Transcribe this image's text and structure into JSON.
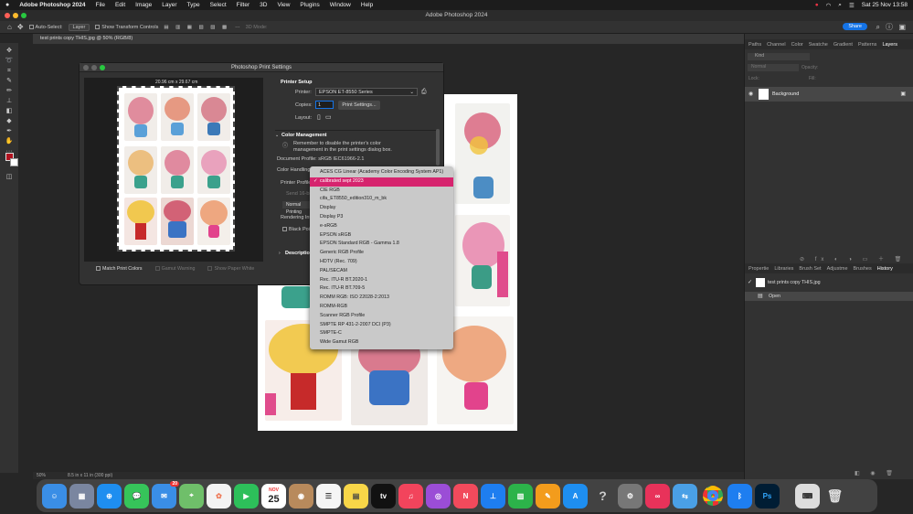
{
  "menubar": {
    "apple": "",
    "app": "Adobe Photoshop 2024",
    "items": [
      "File",
      "Edit",
      "Image",
      "Layer",
      "Type",
      "Select",
      "Filter",
      "3D",
      "View",
      "Plugins",
      "Window",
      "Help"
    ],
    "clock": "Sat 25 Nov 13:58"
  },
  "window": {
    "title": "Adobe Photoshop 2024"
  },
  "options": {
    "auto_select": "Auto-Select:",
    "layer": "Layer",
    "transform": "Show Transform Controls",
    "mode3d": "3D Mode:",
    "share": "Share"
  },
  "document": {
    "tab": "test prints copy THIS.jpg @ 50% (RGB/8)",
    "zoom": "50%",
    "info": "8.5 in x 11 in (300 ppi)"
  },
  "panels": {
    "top_tabs": [
      "Paths",
      "Channel",
      "Color",
      "Swatche",
      "Gradient",
      "Patterns",
      "Layers"
    ],
    "kind": "Kind",
    "normal": "Normal",
    "opacity": "Opacity:",
    "fill": "Fill:",
    "lock": "Lock:",
    "layer_name": "Background",
    "mid_tabs": [
      "Propertie",
      "Libraries",
      "Brush Set",
      "Adjustme",
      "Brushes",
      "History"
    ],
    "history_snapshot": "test prints copy THIS.jpg",
    "history_state": "Open"
  },
  "dialog": {
    "title": "Photoshop Print Settings",
    "size_label": "20.96 cm x 29.67 cm",
    "printer_setup": "Printer Setup",
    "printer_label": "Printer:",
    "printer_value": "EPSON ET-8550 Series",
    "copies_label": "Copies:",
    "copies_value": "1",
    "print_settings_btn": "Print Settings...",
    "layout_label": "Layout:",
    "color_mgmt": "Color Management",
    "reminder": "Remember to disable the printer's color management in the print settings dialog box.",
    "doc_profile": "Document Profile: sRGB IEC61966-2.1",
    "color_handling": "Color Handling:",
    "printer_profile": "Printer Profile:",
    "send16": "Send 16-bit",
    "normal_print": "Normal Printing",
    "rendering": "Rendering Int",
    "black_point": "Black Point",
    "description": "Description",
    "match_colors": "Match Print Colors",
    "gamut": "Gamut Warning",
    "paper_white": "Show Paper White"
  },
  "profiles": {
    "selected_index": 1,
    "items": [
      "ACES CG Linear (Academy Color Encoding System AP1)",
      "calibrated sept 2023",
      "CIE RGB",
      "cifa_ET8550_edition310_m_bk",
      "Display",
      "Display P3",
      "e-sRGB",
      "EPSON  sRGB",
      "EPSON  Standard RGB - Gamma 1.8",
      "Generic RGB Profile",
      "HDTV (Rec. 709)",
      "PAL/SECAM",
      "Rec. ITU-R BT.2020-1",
      "Rec. ITU-R BT.709-5",
      "ROMM RGB: ISO 22028-2:2013",
      "ROMM-RGB",
      "Scanner RGB Profile",
      "SMPTE RP 431-2-2007 DCI (P3)",
      "SMPTE-C",
      "Wide Gamut RGB"
    ]
  },
  "dock": {
    "calendar_month": "NOV",
    "calendar_day": "25",
    "mail_badge": "20",
    "apps": [
      "Finder",
      "Launchpad",
      "Safari",
      "Messages",
      "Mail",
      "Maps",
      "Photos",
      "FaceTime",
      "Calendar",
      "Notes",
      "Reminders",
      "Stickies",
      "Apple TV",
      "Music",
      "Podcasts",
      "News",
      "Keynote",
      "Numbers",
      "Pages",
      "App Store",
      "Help",
      "Settings",
      "Creative Cloud",
      "Migration",
      "Chrome",
      "Bluetooth",
      "Photoshop",
      "Keyboard",
      "Trash"
    ]
  },
  "colors": {
    "accent": "#d6246e",
    "ps_blue": "#1473e6",
    "fg_swatch": "#b0121f"
  }
}
